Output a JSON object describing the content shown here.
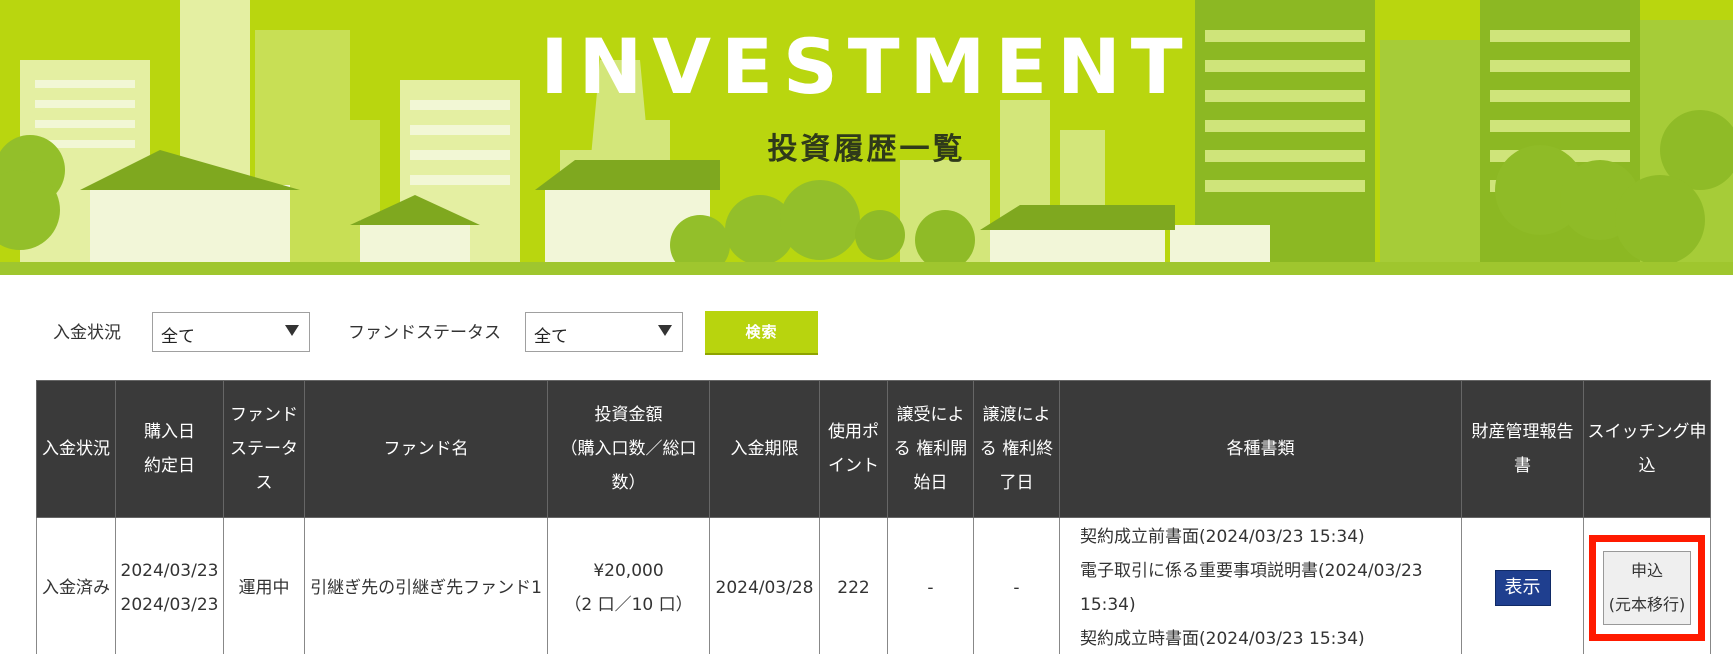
{
  "hero": {
    "title": "INVESTMENT",
    "subtitle": "投資履歴一覧"
  },
  "filters": {
    "payment_label": "入金状況",
    "payment_value": "全て",
    "fund_status_label": "ファンドステータス",
    "fund_status_value": "全て",
    "search_label": "検索"
  },
  "table": {
    "headers": {
      "payment_status": "入金状況",
      "purchase_date_l1": "購入日",
      "purchase_date_l2": "約定日",
      "fund_status": "ファンドステータス",
      "fund_name": "ファンド名",
      "amount_l1": "投資金額",
      "amount_l2": "（購入口数／総口数）",
      "payment_due": "入金期限",
      "points": "使用ポイント",
      "transfer_in_l1": "譲受による",
      "transfer_in_l2": "権利開始日",
      "transfer_out_l1": "譲渡による",
      "transfer_out_l2": "権利終了日",
      "documents": "各種書類",
      "report": "財産管理報告書",
      "switching": "スイッチング申込"
    },
    "rows": [
      {
        "payment_status": "入金済み",
        "purchase_date": "2024/03/23",
        "contract_date": "2024/03/23",
        "fund_status": "運用中",
        "fund_name": "引継ぎ先の引継ぎ先ファンド1",
        "amount": "¥20,000",
        "units": "（2 口／10 口）",
        "payment_due": "2024/03/28",
        "points": "222",
        "transfer_in": "-",
        "transfer_out": "-",
        "documents": [
          "契約成立前書面(2024/03/23 15:34)",
          "電子取引に係る重要事項説明書(2024/03/23 15:34)",
          "契約成立時書面(2024/03/23 15:34)"
        ],
        "report_button": "表示",
        "apply_line1": "申込",
        "apply_line2": "(元本移行)"
      }
    ]
  },
  "colors": {
    "hero_bg": "#b9d60f",
    "header_bg": "#3a3a3a",
    "search_btn": "#b8d40e",
    "show_btn": "#1f3f8f",
    "highlight": "#ff1a00"
  }
}
